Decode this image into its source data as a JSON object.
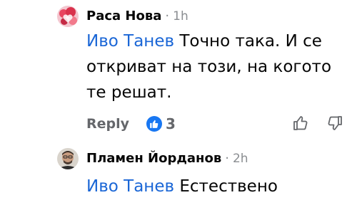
{
  "comments": [
    {
      "author": "Раса Нова",
      "separator": "·",
      "time": "1h",
      "mention": "Иво Танев",
      "text": " Точно така. И се откриват на този, на когото те решат."
    },
    {
      "author": "Пламен Йорданов",
      "separator": "·",
      "time": "2h",
      "mention": "Иво Танев",
      "text": " Естествено"
    }
  ],
  "actions": {
    "reply_label": "Reply",
    "reaction_count": "3",
    "reaction_icon": "like-reaction-icon",
    "upvote_icon": "thumbs-up-icon",
    "downvote_icon": "thumbs-down-icon"
  },
  "colors": {
    "mention": "#1a66d6",
    "meta": "#8a8d91",
    "like_badge": "#1877f2"
  }
}
